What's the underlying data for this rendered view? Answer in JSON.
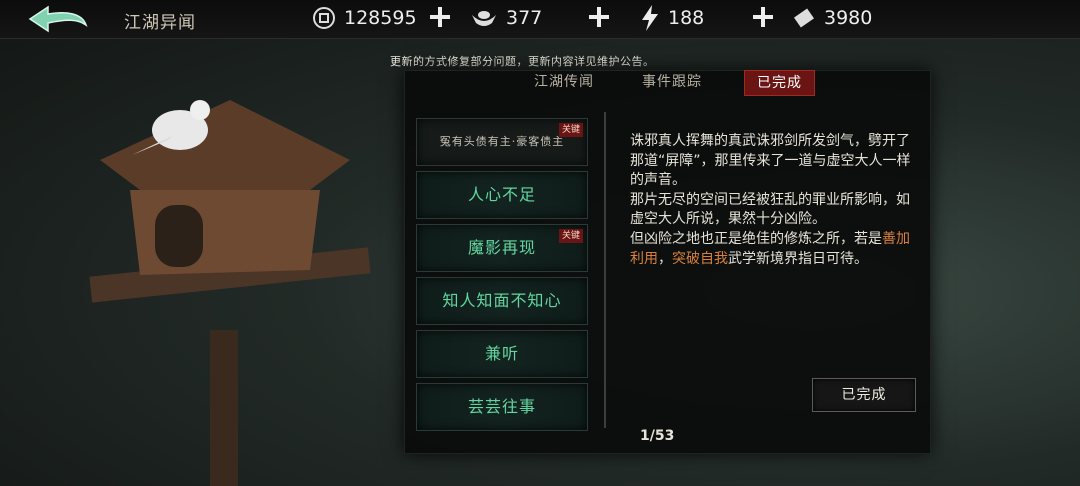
{
  "header": {
    "title": "江湖异闻",
    "resources": {
      "coins": "128595",
      "silver": "377",
      "energy": "188",
      "tickets": "3980"
    }
  },
  "notice": "更新的方式修复部分问题，更新内容详见维护公告。",
  "tabs": [
    {
      "label": "江湖传闻",
      "active": false
    },
    {
      "label": "事件跟踪",
      "active": false
    },
    {
      "label": "已完成",
      "active": true
    }
  ],
  "events": [
    {
      "label": "冤有头债有主·豪客债主",
      "tag": "关键"
    },
    {
      "label": "人心不足",
      "tag": ""
    },
    {
      "label": "魔影再现",
      "tag": "关键"
    },
    {
      "label": "知人知面不知心",
      "tag": ""
    },
    {
      "label": "兼听",
      "tag": ""
    },
    {
      "label": "芸芸往事",
      "tag": ""
    }
  ],
  "detail": {
    "text_part1": "诛邪真人挥舞的真武诛邪剑所发剑气，劈开了那道“屏障”，那里传来了一道与虚空大人一样的声音。",
    "text_part2": "那片无尽的空间已经被狂乱的罪业所影响，如虚空大人所说，果然十分凶险。",
    "text_part3a": "但凶险之地也正是绝佳的修炼之所，若是",
    "highlight1": "善加利用",
    "text_part3b": "，",
    "highlight2": "突破自我",
    "text_part3c": "武学新境界指日可待。",
    "status_button": "已完成"
  },
  "pagination": "1/53",
  "colors": {
    "accent_red": "#6b1414",
    "item_text": "#62d6a0",
    "highlight": "#d9813c"
  }
}
